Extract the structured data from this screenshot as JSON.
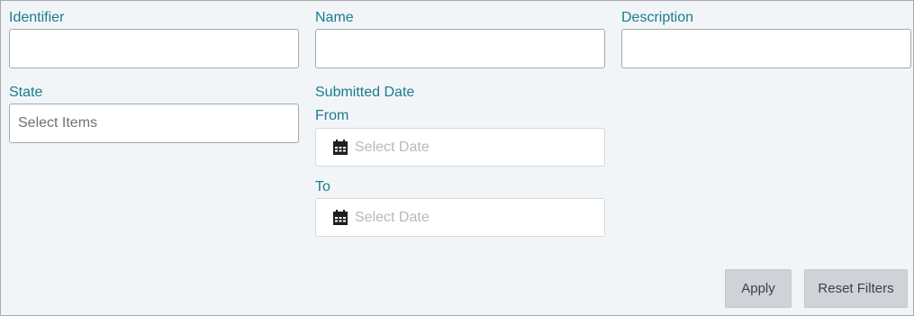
{
  "filters": {
    "identifier": {
      "label": "Identifier",
      "value": ""
    },
    "name": {
      "label": "Name",
      "value": ""
    },
    "description": {
      "label": "Description",
      "value": ""
    },
    "state": {
      "label": "State",
      "placeholder": "Select Items"
    },
    "submitted_date": {
      "label": "Submitted Date",
      "from": {
        "label": "From",
        "placeholder": "Select Date",
        "icon": "calendar-icon"
      },
      "to": {
        "label": "To",
        "placeholder": "Select Date",
        "icon": "calendar-icon"
      }
    }
  },
  "actions": {
    "apply_label": "Apply",
    "reset_label": "Reset Filters"
  },
  "colors": {
    "label_text": "#1b7b8c",
    "panel_bg": "#f2f5f8",
    "button_bg": "#ced3d8"
  }
}
